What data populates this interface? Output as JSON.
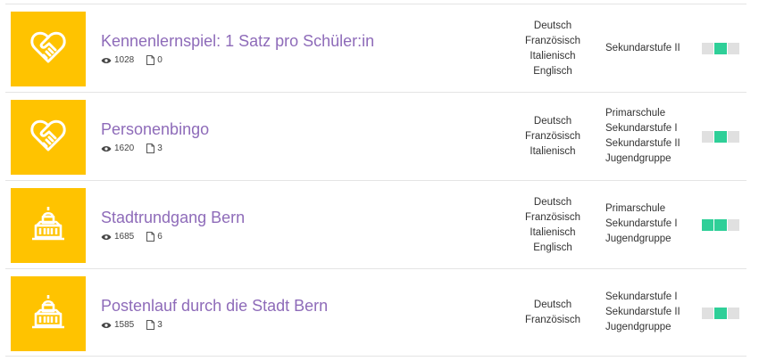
{
  "rows": [
    {
      "icon": "heart-handshake-icon",
      "title": "Kennenlernspiel: 1 Satz pro Schüler:in",
      "views": "1028",
      "docs": "0",
      "languages": [
        "Deutsch",
        "Französisch",
        "Italienisch",
        "Englisch"
      ],
      "levels": [
        "Sekundarstufe II"
      ],
      "level_segments": [
        false,
        true,
        false
      ]
    },
    {
      "icon": "heart-handshake-icon",
      "title": "Personenbingo",
      "views": "1620",
      "docs": "3",
      "languages": [
        "Deutsch",
        "Französisch",
        "Italienisch"
      ],
      "levels": [
        "Primarschule",
        "Sekundarstufe I",
        "Sekundarstufe II",
        "Jugendgruppe"
      ],
      "level_segments": [
        false,
        true,
        false
      ]
    },
    {
      "icon": "government-building-icon",
      "title": "Stadtrundgang Bern",
      "views": "1685",
      "docs": "6",
      "languages": [
        "Deutsch",
        "Französisch",
        "Italienisch",
        "Englisch"
      ],
      "levels": [
        "Primarschule",
        "Sekundarstufe I",
        "Jugendgruppe"
      ],
      "level_segments": [
        true,
        true,
        false
      ]
    },
    {
      "icon": "government-building-icon",
      "title": "Postenlauf durch die Stadt Bern",
      "views": "1585",
      "docs": "3",
      "languages": [
        "Deutsch",
        "Französisch"
      ],
      "levels": [
        "Sekundarstufe I",
        "Sekundarstufe II",
        "Jugendgruppe"
      ],
      "level_segments": [
        false,
        true,
        false
      ]
    }
  ],
  "colors": {
    "tile": "#ffc300",
    "title": "#8e6bb9",
    "segment_on": "#2fcf98",
    "segment_off": "#e0e0e0"
  }
}
